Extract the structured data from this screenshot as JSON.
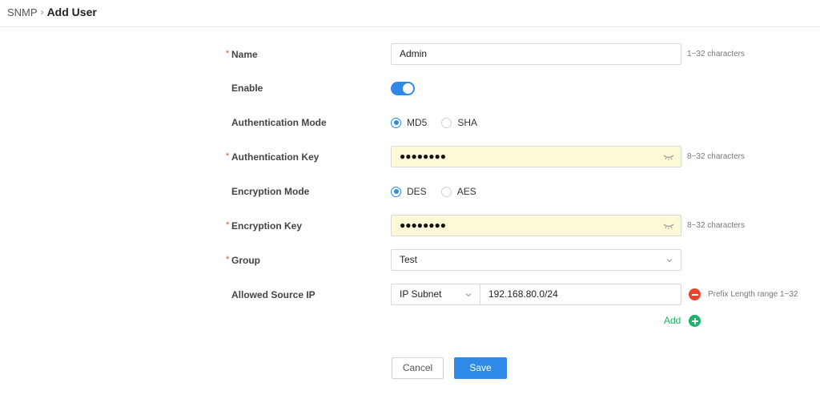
{
  "breadcrumb": {
    "parent": "SNMP",
    "separator": "›",
    "current": "Add User"
  },
  "required_marker": "*",
  "form": {
    "name": {
      "label": "Name",
      "value": "Admin",
      "hint": "1~32 characters"
    },
    "enable": {
      "label": "Enable",
      "on": true
    },
    "auth_mode": {
      "label": "Authentication Mode",
      "options": [
        "MD5",
        "SHA"
      ],
      "selected": "MD5"
    },
    "auth_key": {
      "label": "Authentication Key",
      "masked": "●●●●●●●●",
      "hint": "8~32 characters"
    },
    "enc_mode": {
      "label": "Encryption Mode",
      "options": [
        "DES",
        "AES"
      ],
      "selected": "DES"
    },
    "enc_key": {
      "label": "Encryption Key",
      "masked": "●●●●●●●●",
      "hint": "8~32 characters"
    },
    "group": {
      "label": "Group",
      "value": "Test"
    },
    "source_ip": {
      "label": "Allowed Source IP",
      "type": "IP Subnet",
      "value": "192.168.80.0/24",
      "hint": "Prefix Length range 1~32"
    },
    "add_label": "Add"
  },
  "buttons": {
    "cancel": "Cancel",
    "save": "Save"
  },
  "colors": {
    "primary": "#2e8ae6",
    "required": "#e34d36",
    "remove": "#e8452f",
    "add": "#1ab36b",
    "autofill": "#fdf8d6"
  }
}
